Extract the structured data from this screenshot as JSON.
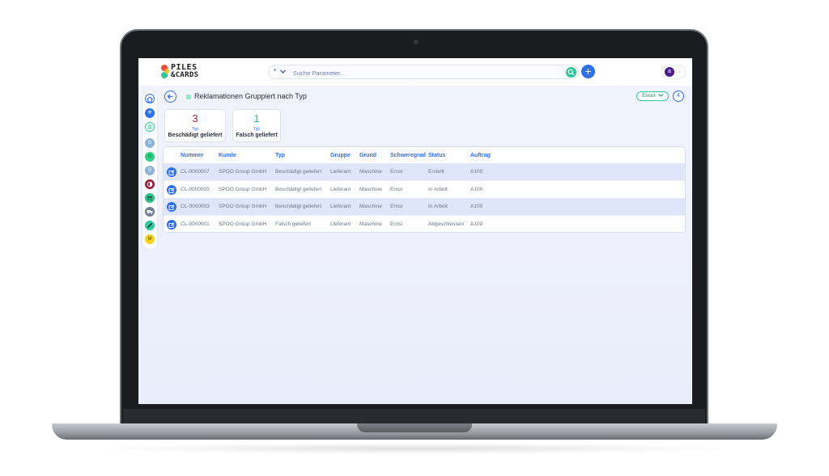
{
  "brand": {
    "line1": "PILES",
    "line2": "&CARDS"
  },
  "search": {
    "select_label": "*",
    "placeholder": "Suche Parameter..."
  },
  "user": {
    "avatar_initial": "a"
  },
  "rail": {
    "items": [
      "G",
      "G",
      "G",
      "M"
    ]
  },
  "page": {
    "title": "Reklamationen Gruppiert nach Typ"
  },
  "toolbar": {
    "excel_label": "Excel",
    "count": "4"
  },
  "cards": [
    {
      "count": "3",
      "sub": "Typ",
      "label": "Beschädigt geliefert",
      "color": "#b3223c"
    },
    {
      "count": "1",
      "sub": "Typ",
      "label": "Falsch geliefert",
      "color": "#1fb8a0"
    }
  ],
  "table": {
    "columns": [
      "Nummer",
      "Kunde",
      "Typ",
      "Gruppe",
      "Grund",
      "Schweregrad",
      "Status",
      "Auftrag"
    ],
    "rows": [
      [
        "CL-0000007",
        "SPOO Group GmbH",
        "Beschädigt geliefert",
        "Lieferant",
        "Maschine",
        "Ernst",
        "Erstellt",
        "A100"
      ],
      [
        "CL-0000005",
        "SPOO Group GmbH",
        "Beschädigt geliefert",
        "Lieferant",
        "Maschine",
        "Ernst",
        "In Arbeit",
        "A100"
      ],
      [
        "CL-0000003",
        "SPOO Group GmbH",
        "Beschädigt geliefert",
        "Lieferant",
        "Maschine",
        "Ernst",
        "In Arbeit",
        "A100"
      ],
      [
        "CL-0000001",
        "SPOO Group GmbH",
        "Falsch geliefert",
        "Lieferant",
        "Maschine",
        "Ernst",
        "Abgeschlossen",
        "A100"
      ]
    ]
  },
  "colors": {
    "accent": "#2f6fe8",
    "success": "#2fc79b"
  }
}
